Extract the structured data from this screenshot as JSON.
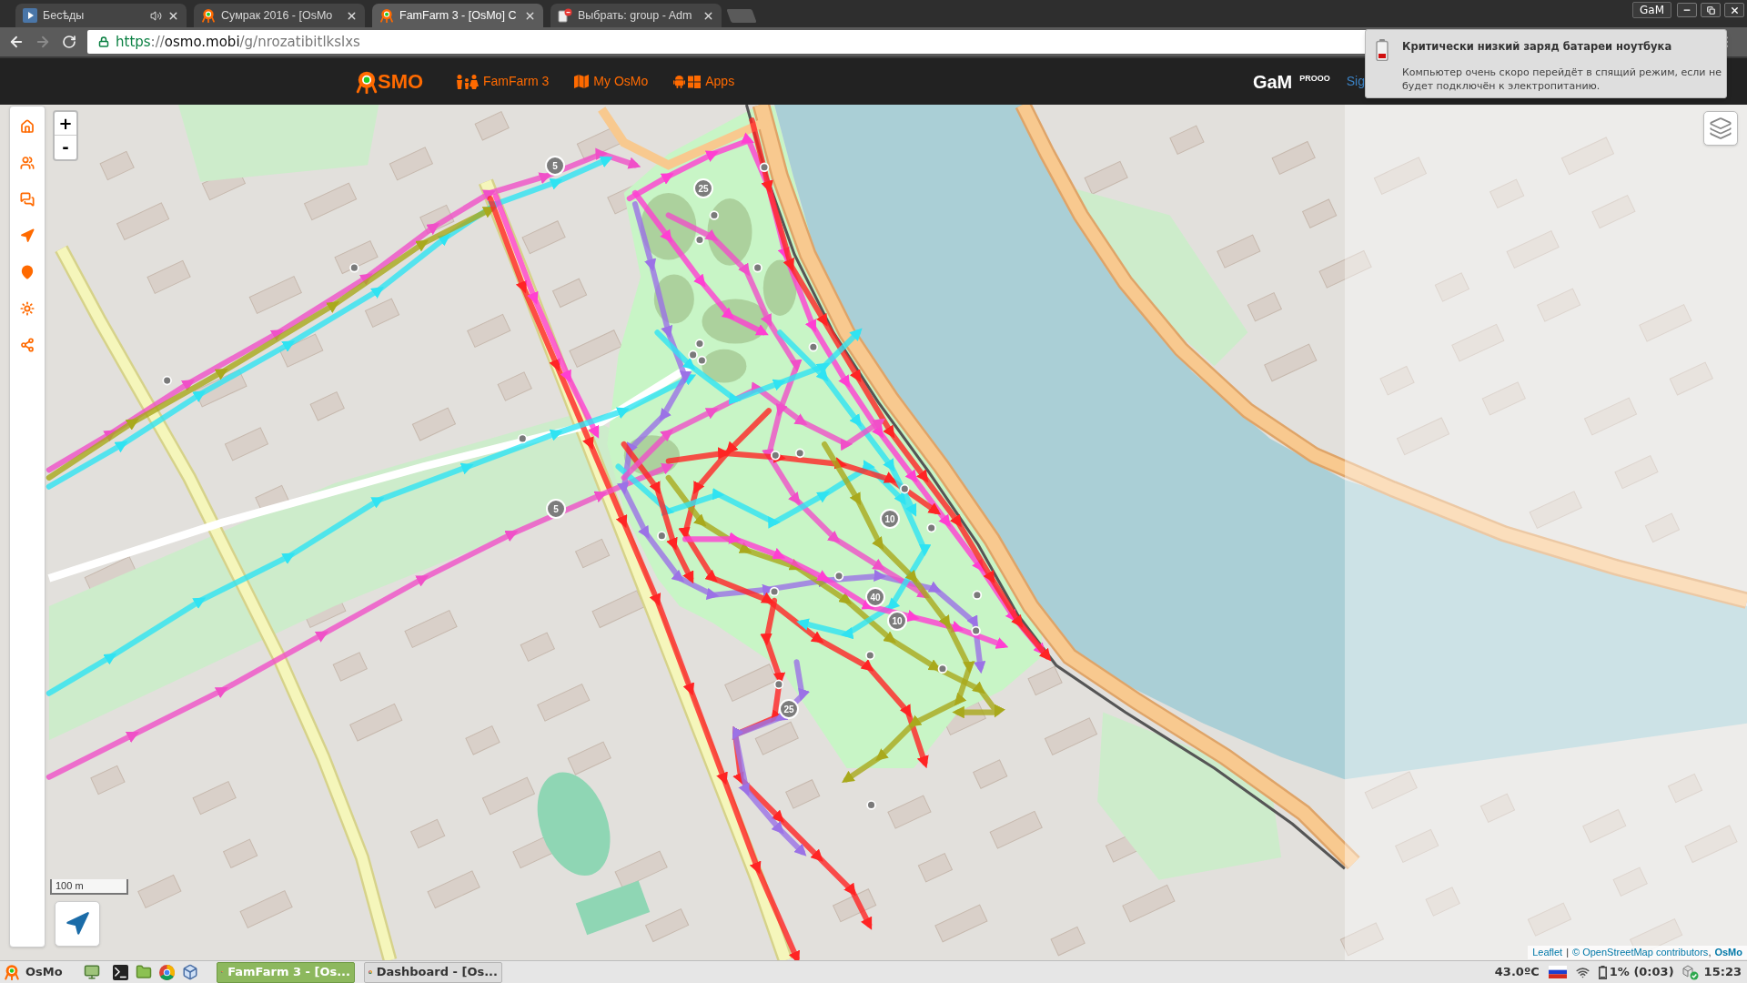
{
  "browser": {
    "tabs": [
      {
        "title": "Бесѣды",
        "kind": "play",
        "audio": true,
        "selected": false
      },
      {
        "title": "Сумрак 2016 - [OsMo",
        "kind": "osmo",
        "audio": false,
        "selected": false
      },
      {
        "title": "FamFarm 3 - [OsMo] C",
        "kind": "osmo",
        "audio": false,
        "selected": true
      },
      {
        "title": "Выбрать: group - Adm",
        "kind": "page",
        "audio": false,
        "selected": false
      }
    ],
    "profile": "GaM",
    "address": [
      {
        "text": "https",
        "kind": "scheme"
      },
      {
        "text": "://",
        "kind": "path"
      },
      {
        "text": "osmo.mobi",
        "kind": "host"
      },
      {
        "text": "/g/nrozatibitlkslxs",
        "kind": "path"
      }
    ]
  },
  "notification": {
    "title": "Критически низкий заряд батареи ноутбука",
    "body": "Компьютер очень скоро перейдёт в спящий режим, если не будет подключён к электропитанию."
  },
  "header": {
    "logo": "SMO",
    "nav": [
      {
        "label": "FamFarm 3",
        "kind": "family"
      },
      {
        "label": "My OsMo",
        "kind": "map"
      },
      {
        "label": "Apps",
        "kind": "apps"
      }
    ],
    "user": "GaM",
    "badge": "PROOO",
    "sign_in": "Sig"
  },
  "map": {
    "zoom_in": "+",
    "zoom_out": "-",
    "markers": [
      {
        "label": "5"
      },
      {
        "label": "25"
      },
      {
        "label": "5"
      },
      {
        "label": "10"
      },
      {
        "label": "40"
      },
      {
        "label": "10"
      },
      {
        "label": "25"
      }
    ],
    "scale": "100 m",
    "attribution": [
      {
        "text": "Leaflet",
        "kind": "link"
      },
      {
        "text": "|",
        "kind": "separator"
      },
      {
        "text": "© OpenStreetMap contributors",
        "kind": "link"
      },
      {
        "text": ",",
        "kind": "punct"
      },
      {
        "text": "OsMo",
        "kind": "strong_link"
      }
    ]
  },
  "taskbar": {
    "start": "OsMo",
    "windows": [
      {
        "title": "FamFarm 3 - [Os...",
        "selected": true
      },
      {
        "title": "Dashboard - [Os...",
        "selected": false
      }
    ],
    "temperature": "43.0ºC",
    "battery": "1% (0:03)",
    "clock": "15:23"
  }
}
